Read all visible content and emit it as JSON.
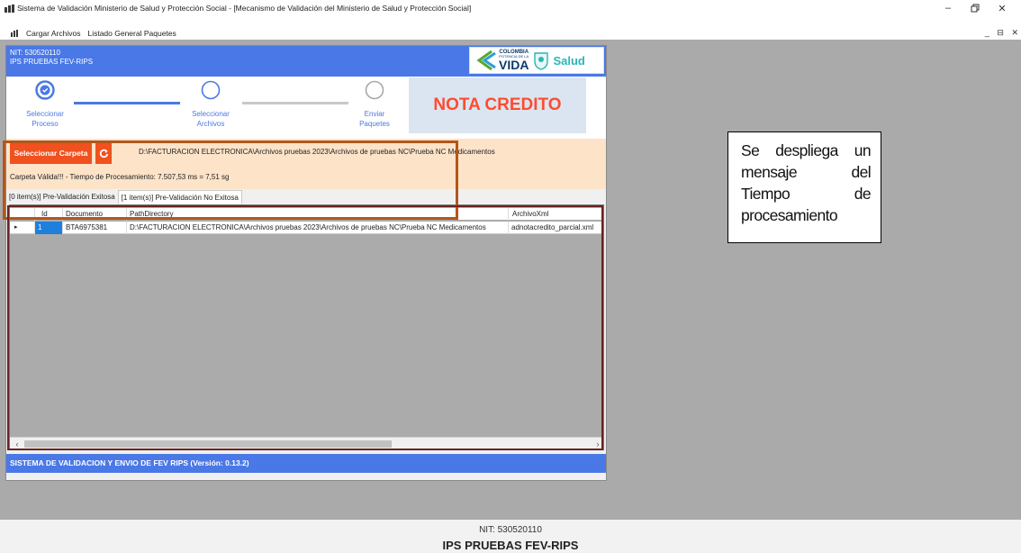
{
  "window": {
    "title": "Sistema de Validación Ministerio de Salud y Protección Social - [Mecanismo de Validación del Ministerio de Salud y Protección Social]",
    "minimize_icon": "minimize-icon",
    "maximize_icon": "restore-icon",
    "close_icon": "close-icon"
  },
  "menu": {
    "items": [
      "Cargar Archivos",
      "Listado General Paquetes"
    ]
  },
  "child": {
    "header": {
      "nit": "NIT: 530520110",
      "ips": "IPS PRUEBAS FEV-RIPS"
    },
    "logo": {
      "colombia": "COLOMBIA",
      "potencia": "POTENCIA DE LA",
      "vida": "VIDA",
      "salud": "Salud"
    },
    "steps": [
      {
        "label": "Seleccionar Proceso",
        "line1": "Seleccionar",
        "line2": "Proceso",
        "state": "completed"
      },
      {
        "label": "Seleccionar Archivos",
        "line1": "Seleccionar",
        "line2": "Archivos",
        "state": "active"
      },
      {
        "label": "Enviar Paquetes",
        "line1": "Enviar",
        "line2": "Paquetes",
        "state": "pending"
      }
    ],
    "nota": "NOTA CREDITO",
    "select_folder_label": "Seleccionar Carpeta",
    "refresh_icon": "refresh-icon",
    "folder_path": "D:\\FACTURACION ELECTRONICA\\Archivos pruebas 2023\\Archivos de pruebas NC\\Prueba NC Medicamentos",
    "validation_msg": "Carpeta Válida!!! - Tiempo de Procesamiento: 7.507,53 ms = 7,51 sg",
    "tabs": [
      "[0 item(s)] Pre-Validación Exitosa",
      "[1 item(s)] Pre-Validación No Exitosa"
    ],
    "active_tab": 1,
    "grid": {
      "columns": [
        "",
        "Id",
        "Documento",
        "PathDirectory",
        "ArchivoXml"
      ],
      "rows": [
        [
          "▸",
          "1",
          "BTA6975381",
          "D:\\FACTURACION ELECTRONICA\\Archivos pruebas 2023\\Archivos de pruebas NC\\Prueba NC Medicamentos",
          "adnotacredito_parcial.xml"
        ]
      ]
    },
    "footer": "SISTEMA DE VALIDACION Y ENVIO DE FEV RIPS  (Versión: 0.13.2)"
  },
  "callout": {
    "text": "Se despliega un mensaje del Tiempo de procesamiento"
  },
  "bottom": {
    "nit": "NIT: 530520110",
    "ips": "IPS PRUEBAS FEV-RIPS"
  },
  "colors": {
    "header_blue": "#4a78e6",
    "accent_orange": "#f0511e",
    "nota_red": "#ff4c2e",
    "panel_peach": "#fde3c8"
  }
}
